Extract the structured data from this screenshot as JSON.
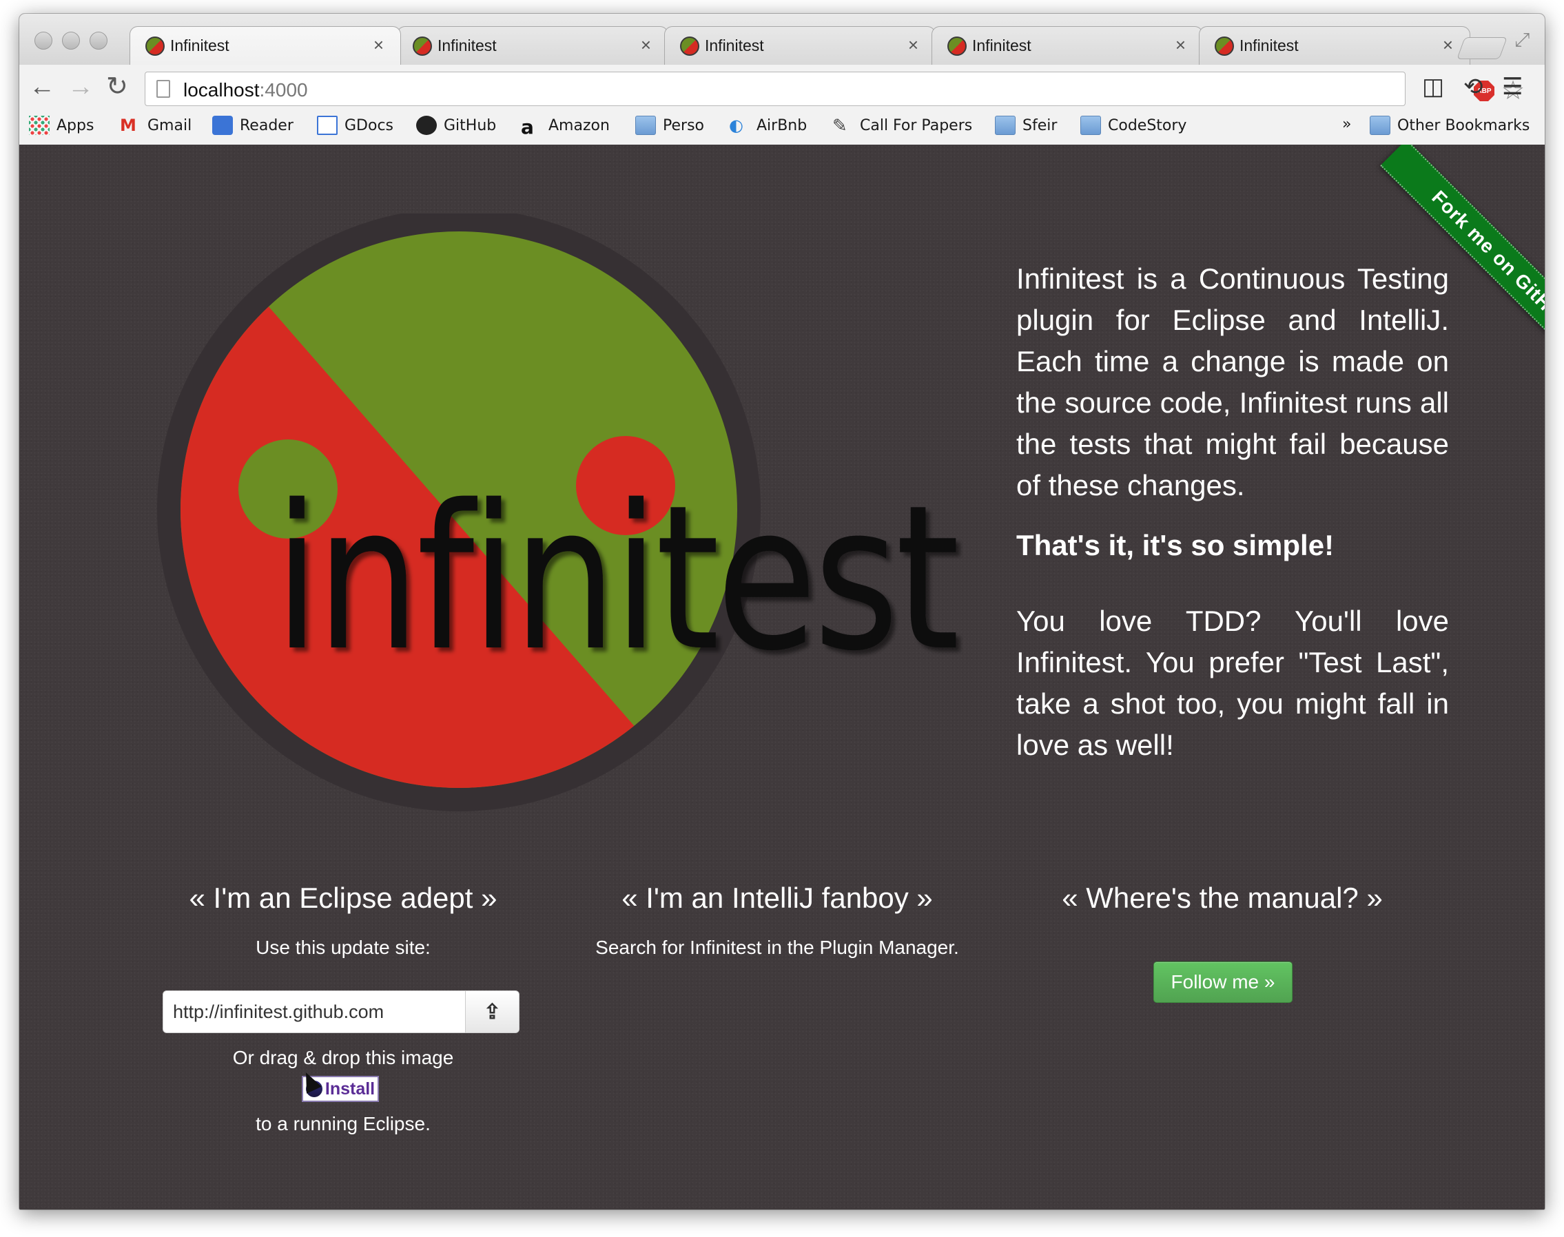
{
  "browser": {
    "tabs": [
      {
        "title": "Infinitest",
        "close": "×"
      },
      {
        "title": "Infinitest",
        "close": "×"
      },
      {
        "title": "Infinitest",
        "close": "×"
      },
      {
        "title": "Infinitest",
        "close": "×"
      },
      {
        "title": "Infinitest",
        "close": "×"
      }
    ],
    "url_host": "localhost",
    "url_port": ":4000",
    "abp_label": "ABP",
    "bookmarks": [
      {
        "label": "Apps",
        "icon": "apps-grid-icon"
      },
      {
        "label": "Gmail",
        "icon": "gmail-icon"
      },
      {
        "label": "Reader",
        "icon": "reader-icon"
      },
      {
        "label": "GDocs",
        "icon": "gdocs-icon"
      },
      {
        "label": "GitHub",
        "icon": "github-icon"
      },
      {
        "label": "Amazon",
        "icon": "amazon-icon"
      },
      {
        "label": "Perso",
        "icon": "folder-icon"
      },
      {
        "label": "AirBnb",
        "icon": "airbnb-icon"
      },
      {
        "label": "Call For Papers",
        "icon": "cfp-icon"
      },
      {
        "label": "Sfeir",
        "icon": "folder-icon"
      },
      {
        "label": "CodeStory",
        "icon": "folder-icon"
      }
    ],
    "overflow": "»",
    "other_bookmarks": "Other Bookmarks"
  },
  "page": {
    "logo_text": "infinitest",
    "intro": "Infinitest is a Continuous Testing plugin for Eclipse and IntelliJ. Each time a change is made on the source code, Infinitest runs all the tests that might fail because of these changes.",
    "tagline": "That's it, it's so simple!",
    "pitch": "You love TDD? You'll love Infinitest. You prefer \"Test Last\", take a shot too, you might fall in love as well!",
    "eclipse": {
      "title": "« I'm an Eclipse adept »",
      "instruction": "Use this update site:",
      "update_url": "http://infinitest.github.com",
      "drag_text": "Or drag & drop this image",
      "install_label": "Install",
      "running_text": "to a running Eclipse."
    },
    "intellij": {
      "title": "« I'm an IntelliJ fanboy »",
      "instruction": "Search for Infinitest in the Plugin Manager."
    },
    "manual": {
      "title": "« Where's the manual? »",
      "button": "Follow me »"
    },
    "fork_ribbon": "Fork me on GitHub"
  },
  "colors": {
    "logo_green": "#6b8e23",
    "logo_red": "#d62b22",
    "ribbon_green": "#0b7a1b",
    "follow_button": "#5bb75b"
  }
}
